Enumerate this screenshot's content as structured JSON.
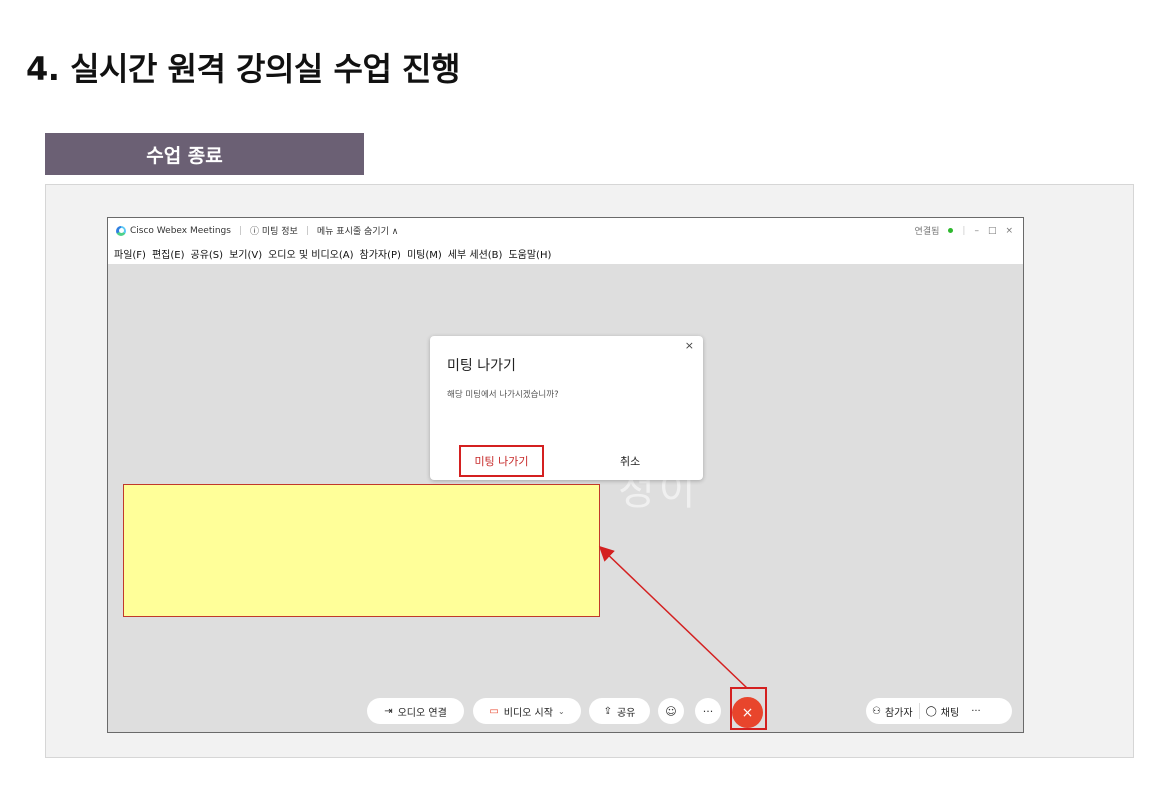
{
  "page": {
    "title": "4. 실시간 원격 강의실 수업 진행",
    "section_tab": "수업 종료"
  },
  "window": {
    "app_name": "Cisco Webex Meetings",
    "meeting_info": "ⓘ 미팅 정보",
    "menu_toggle": "메뉴 표시줄 숨기기 ∧",
    "status": "연결됨",
    "status_color": "#2eb82e",
    "minimize": "–",
    "maximize": "□",
    "close": "×"
  },
  "menubar": {
    "items": [
      "파일(F)",
      "편집(E)",
      "공유(S)",
      "보기(V)",
      "오디오 및 비디오(A)",
      "참가자(P)",
      "미팅(M)",
      "세부 세션(B)",
      "도움말(H)"
    ]
  },
  "dialog": {
    "close": "×",
    "title": "미팅 나가기",
    "message": "해당 미팅에서 나가시겠습니까?",
    "leave_button": "미팅 나가기",
    "cancel_button": "취소",
    "highlight_color": "#d42020"
  },
  "background_text": "정이",
  "controls": {
    "audio": "오디오 연결",
    "video": "비디오 시작",
    "share": "공유",
    "emoji_icon": "smile-icon",
    "more": "···",
    "end": "×",
    "end_color": "#e8452c",
    "participants": "참가자",
    "chat": "채팅",
    "right_more": "···"
  },
  "colors": {
    "section_tab_bg": "#6b6074",
    "callout_fill": "#ffff99",
    "annotation_red": "#d42020"
  }
}
